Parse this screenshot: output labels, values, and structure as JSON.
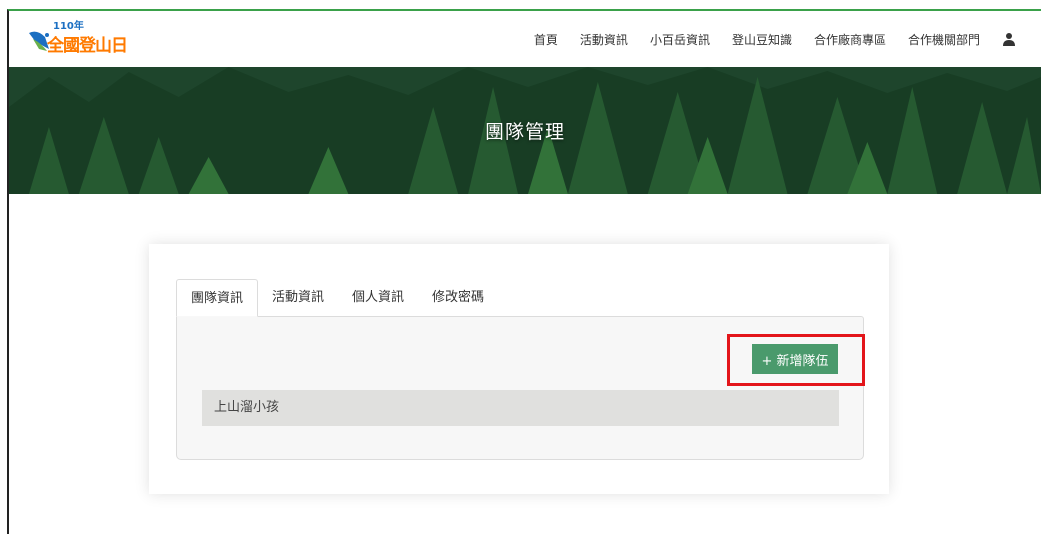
{
  "logo": {
    "year": "110年",
    "text": "全國登山日"
  },
  "nav": {
    "items": [
      "首頁",
      "活動資訊",
      "小百岳資訊",
      "登山豆知識",
      "合作廠商專區",
      "合作機關部門"
    ]
  },
  "hero": {
    "title": "團隊管理"
  },
  "tabs": [
    "團隊資訊",
    "活動資訊",
    "個人資訊",
    "修改密碼"
  ],
  "panel": {
    "add_button_label": "+ 新增隊伍",
    "teams": [
      "上山溜小孩"
    ]
  },
  "colors": {
    "accent_green": "#4a9a6c",
    "highlight_red": "#e3151a",
    "logo_orange": "#ff7a00"
  }
}
